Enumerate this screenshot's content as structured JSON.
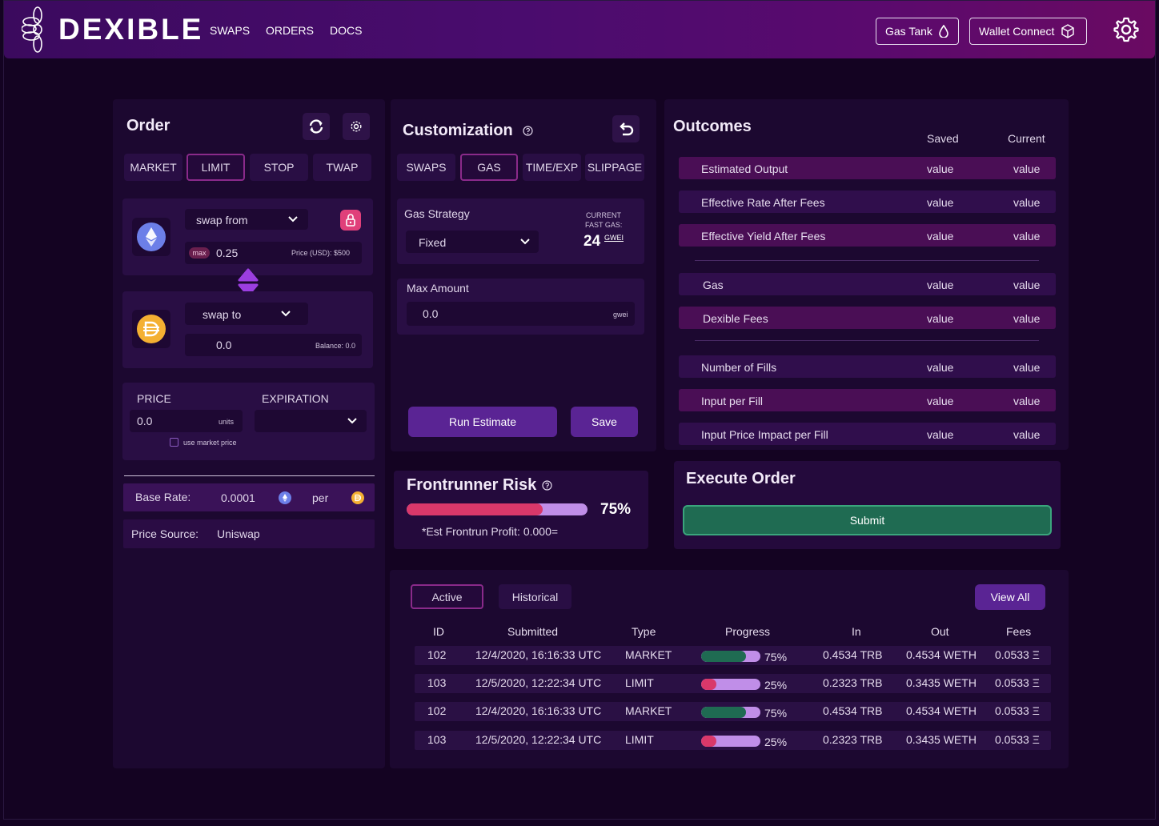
{
  "app": {
    "brand": "DEXIBLE",
    "nav": [
      "SWAPS",
      "ORDERS",
      "DOCS"
    ],
    "gas_tank_label": "Gas Tank",
    "wallet_connect_label": "Wallet Connect"
  },
  "order": {
    "title": "Order",
    "tabs": [
      "MARKET",
      "LIMIT",
      "STOP",
      "TWAP"
    ],
    "active_tab": "LIMIT",
    "swap_from_label": "swap from",
    "max_label": "max",
    "from_amount": "0.25",
    "from_price": "Price (USD): $500",
    "swap_to_label": "swap to",
    "to_amount": "0.0",
    "to_balance": "Balance: 0.0",
    "price_label": "PRICE",
    "price_value": "0.0",
    "price_units": "units",
    "use_market_price": "use market price",
    "expiration_label": "EXPIRATION",
    "base_rate_label": "Base Rate:",
    "base_rate_value": "0.0001",
    "per_label": "per",
    "price_source_label": "Price Source:",
    "price_source_value": "Uniswap"
  },
  "customization": {
    "title": "Customization",
    "tabs": [
      "SWAPS",
      "GAS",
      "TIME/EXP",
      "SLIPPAGE"
    ],
    "active_tab": "GAS",
    "gas_strategy_label": "Gas Strategy",
    "gas_strategy_value": "Fixed",
    "current_fast_gas_line1": "CURRENT",
    "current_fast_gas_line2": "FAST GAS:",
    "fast_gas_value": "24",
    "fast_gas_unit": "GWEI",
    "max_amount_label": "Max Amount",
    "max_amount_value": "0.0",
    "max_amount_unit": "gwei",
    "run_estimate_label": "Run Estimate",
    "save_label": "Save"
  },
  "frontrunner": {
    "title": "Frontrunner Risk",
    "risk_percent": "75%",
    "risk_fraction": 0.75,
    "est_profit": "*Est Frontrun Profit: 0.000="
  },
  "outcomes": {
    "title": "Outcomes",
    "col_saved": "Saved",
    "col_current": "Current",
    "rows": [
      {
        "label": "Estimated Output",
        "saved": "value",
        "current": "value"
      },
      {
        "label": "Effective Rate After Fees",
        "saved": "value",
        "current": "value"
      },
      {
        "label": "Effective Yield After Fees",
        "saved": "value",
        "current": "value"
      },
      {
        "label": "Gas",
        "saved": "value",
        "current": "value"
      },
      {
        "label": "Dexible Fees",
        "saved": "value",
        "current": "value"
      },
      {
        "label": "Number of Fills",
        "saved": "value",
        "current": "value"
      },
      {
        "label": "Input per Fill",
        "saved": "value",
        "current": "value"
      },
      {
        "label": "Input Price Impact per Fill",
        "saved": "value",
        "current": "value"
      }
    ]
  },
  "execute": {
    "title": "Execute Order",
    "submit_label": "Submit"
  },
  "orders_table": {
    "tabs": [
      "Active",
      "Historical"
    ],
    "active_tab": "Active",
    "view_all_label": "View All",
    "headers": [
      "ID",
      "Submitted",
      "Type",
      "Progress",
      "In",
      "Out",
      "Fees"
    ],
    "rows": [
      {
        "id": "102",
        "submitted": "12/4/2020, 16:16:33 UTC",
        "type": "MARKET",
        "progress": "75%",
        "progress_fraction": 0.75,
        "in": "0.4534 TRB",
        "out": "0.4534 WETH",
        "fees": "0.0533 Ξ"
      },
      {
        "id": "103",
        "submitted": "12/5/2020, 12:22:34 UTC",
        "type": "LIMIT",
        "progress": "25%",
        "progress_fraction": 0.25,
        "in": "0.2323 TRB",
        "out": "0.3435 WETH",
        "fees": "0.0533 Ξ"
      },
      {
        "id": "102",
        "submitted": "12/4/2020, 16:16:33 UTC",
        "type": "MARKET",
        "progress": "75%",
        "progress_fraction": 0.75,
        "in": "0.4534 TRB",
        "out": "0.4534 WETH",
        "fees": "0.0533 Ξ"
      },
      {
        "id": "103",
        "submitted": "12/5/2020, 12:22:34 UTC",
        "type": "LIMIT",
        "progress": "25%",
        "progress_fraction": 0.25,
        "in": "0.2323 TRB",
        "out": "0.3435 WETH",
        "fees": "0.0533 Ξ"
      }
    ]
  },
  "colors": {
    "market_progress": "#1f6b52",
    "limit_progress": "#d9386a",
    "progress_track": "#c08ee8",
    "submit_green": "#1f6b52",
    "accent_purple": "#5a2494"
  }
}
